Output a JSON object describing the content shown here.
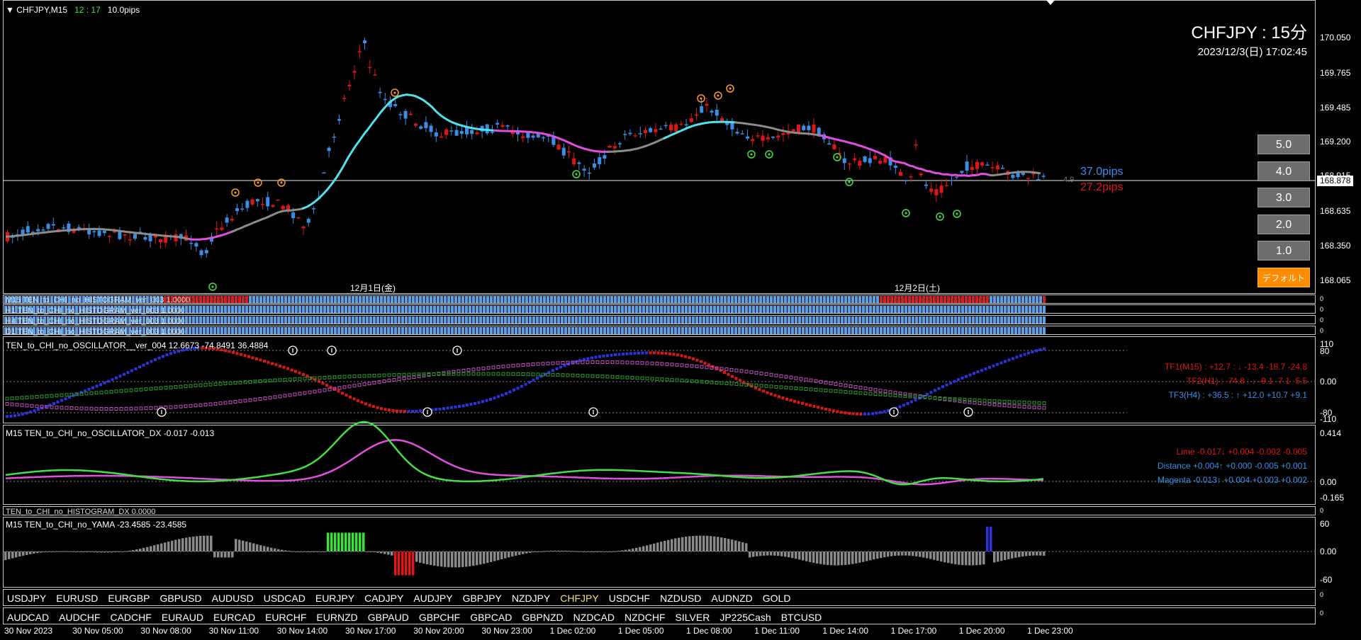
{
  "main_chart": {
    "header_symbol": "CHFJPY,M15",
    "header_time": "12 : 17",
    "header_spread": "10.0pips",
    "big_title": "CHFJPY : 15分",
    "big_date": "2023/12/3(日) 17:02:45",
    "price_labels": [
      "170.050",
      "169.765",
      "169.485",
      "169.200",
      "168.915",
      "168.635",
      "168.350",
      "168.065"
    ],
    "current_price": "168.878",
    "pips_blue": "37.0pips",
    "pips_red": "27.2pips",
    "small_value": "4.9",
    "date_label_1": "12月1日(金)",
    "date_label_2": "12月2日(土)"
  },
  "buttons": [
    "5.0",
    "4.0",
    "3.0",
    "2.0",
    "1.0"
  ],
  "default_button": "デフォルト",
  "histograms": [
    {
      "label": "M15 TEN_to_CHI_no_HISTOGRAM_ver_003 1.0000",
      "scale": "0"
    },
    {
      "label": "H1 TEN_to_CHI_no_HISTOGRAM_ver_003 1.0000",
      "scale": "0"
    },
    {
      "label": "H4 TEN_to_CHI_no_HISTOGRAM_ver_003 1.0000",
      "scale": "0"
    },
    {
      "label": "D1 TEN_to_CHI_no_HISTOGRAM_ver_003 1.0000",
      "scale": "0"
    }
  ],
  "oscillator": {
    "title": "TEN_to_CHI_no_OSCILLATOR__ver_004 12.6673 -74.8491 36.4884",
    "scale_top": "110",
    "scale_80": "80",
    "scale_0": "0.00",
    "scale_m80": "-80",
    "scale_bottom": "-110",
    "tf1": "TF1(M15) : +12.7 : ↓ -13.4 -18.7 -24.8",
    "tf2": "TF2(H1) : -74.8 : ↓ -9.1 -7.1 -5.5",
    "tf3": "TF3(H4) : +36.5 : ↑ +12.0 +10.7 +9.1"
  },
  "dx": {
    "title": "M15 TEN_to_CHI_no_OSCILLATOR_DX -0.017 -0.013",
    "scale_top": "0.414",
    "scale_0": "0.00",
    "scale_bottom": "-0.165",
    "lime": "Lime -0.017↓ +0.004 -0.002 -0.005",
    "distance": "Distance +0.004↑ +0.000 -0.005 +0.001",
    "magenta": "Magenta -0.013↑ +0.004 +0.003 +0.002"
  },
  "histogram_dx": {
    "label": "TEN_to_CHI_no_HISTOGRAM_DX 0.0000",
    "scale": "0"
  },
  "yama": {
    "title": "M15 TEN_to_CHI_no_YAMA -23.4585 -23.4585",
    "scale_top": "60",
    "scale_0": "0.00",
    "scale_bottom": "-60"
  },
  "symbols_row1": [
    "USDJPY",
    "EURUSD",
    "EURGBP",
    "GBPUSD",
    "AUDUSD",
    "USDCAD",
    "EURJPY",
    "CADJPY",
    "AUDJPY",
    "GBPJPY",
    "NZDJPY",
    "CHFJPY",
    "USDCHF",
    "NZDUSD",
    "AUDNZD",
    "GOLD"
  ],
  "active_symbol": "CHFJPY",
  "symbols_row2": [
    "AUDCAD",
    "AUDCHF",
    "CADCHF",
    "EURAUD",
    "EURCAD",
    "EURCHF",
    "EURNZD",
    "GBPAUD",
    "GBPCHF",
    "GBPCAD",
    "GBPNZD",
    "NZDCAD",
    "NZDCHF",
    "SILVER",
    "JP225Cash",
    "BTCUSD"
  ],
  "symbol_scale_1": "0",
  "symbol_scale_2": "0",
  "time_labels": [
    "30 Nov 2023",
    "30 Nov 05:00",
    "30 Nov 08:00",
    "30 Nov 11:00",
    "30 Nov 14:00",
    "30 Nov 17:00",
    "30 Nov 20:00",
    "30 Nov 23:00",
    "1 Dec 02:00",
    "1 Dec 05:00",
    "1 Dec 08:00",
    "1 Dec 11:00",
    "1 Dec 14:00",
    "1 Dec 17:00",
    "1 Dec 20:00",
    "1 Dec 23:00"
  ],
  "colors": {
    "bull": "#3a8ee6",
    "bear": "#e01515",
    "cyan": "#4fe3ee",
    "magenta": "#e24ee0",
    "gray": "#8c8c8c",
    "lime": "#43e043",
    "orange": "#ff9a2e",
    "green_marker": "#43e043"
  }
}
